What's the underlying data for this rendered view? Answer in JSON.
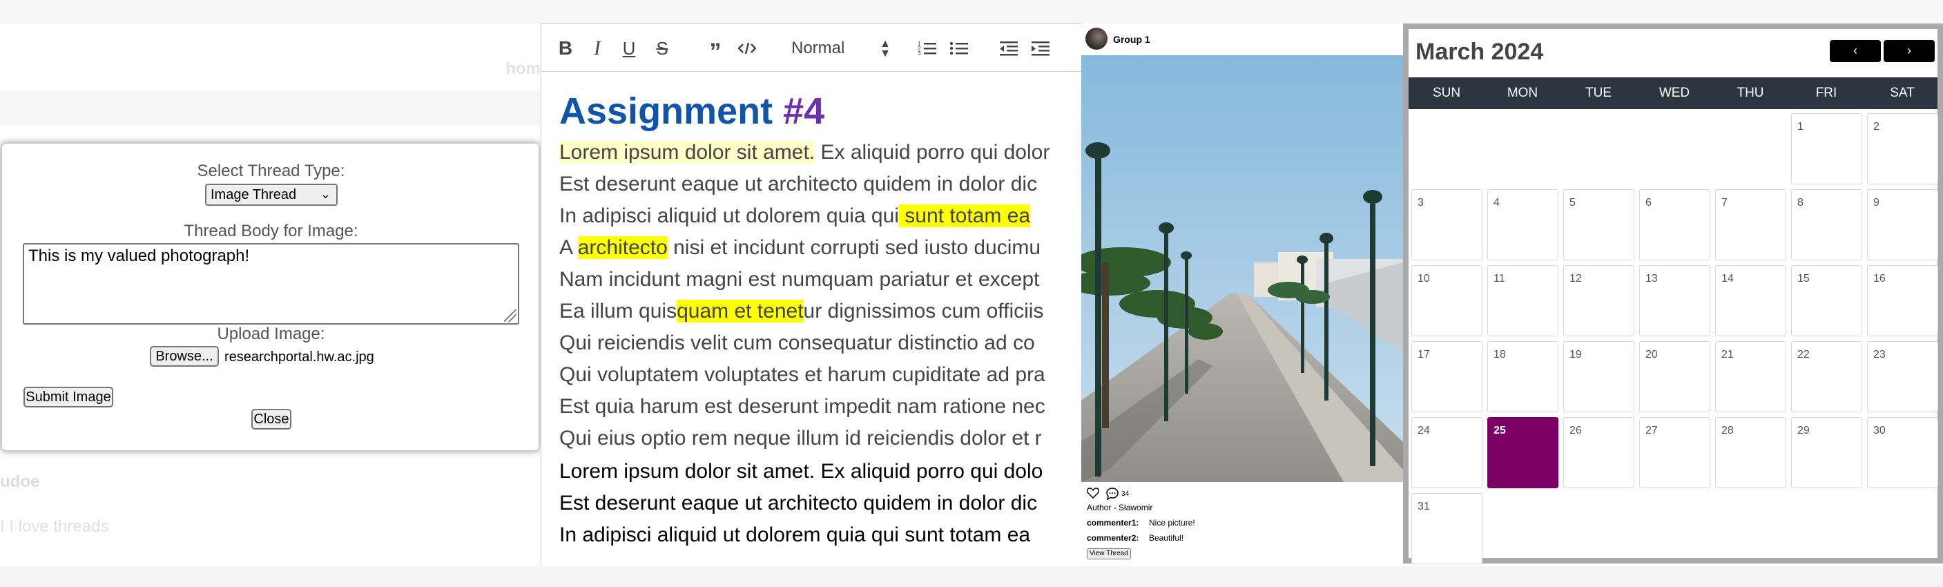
{
  "panel1": {
    "nav_home": "hom",
    "modal": {
      "select_label": "Select Thread Type:",
      "select_value": "Image Thread",
      "body_label": "Thread Body for Image:",
      "body_value": "This is my valued photograph!",
      "upload_label": "Upload Image:",
      "browse_label": "Browse...",
      "file_name": "researchportal.hw.ac.jpg",
      "submit_label": "Submit Image",
      "close_label": "Close"
    },
    "bg_author": "udoe",
    "bg_body": "I I love threads"
  },
  "panel2": {
    "toolbar": {
      "bold": "B",
      "italic": "I",
      "underline": "U",
      "strike": "S",
      "heading_select": "Normal"
    },
    "heading_main": "Assignment ",
    "heading_num": "#4",
    "lines": [
      [
        "",
        "Lorem ipsum dolor sit amet.",
        " Ex aliquid porro qui dolor"
      ],
      [
        "Est deserunt eaque ut architecto quidem in dolor dic",
        "",
        ""
      ],
      [
        "In adipisci aliquid ut dolorem quia qui",
        " sunt totam ea",
        ""
      ],
      [
        "A ",
        "architecto",
        " nisi et incidunt corrupti sed iusto ducimu"
      ],
      [
        "Nam incidunt magni est numquam pariatur et except",
        "",
        ""
      ],
      [
        "Ea illum quis",
        "quam et tenet",
        "ur dignissimos cum officiis"
      ],
      [
        "Qui reiciendis velit cum consequatur distinctio ad co",
        "",
        ""
      ],
      [
        "Qui voluptatem voluptates et harum cupiditate ad pra",
        "",
        ""
      ],
      [
        "Est quia harum est deserunt impedit nam ratione nec",
        "",
        ""
      ],
      [
        "Qui eius optio rem neque illum id reiciendis dolor et r",
        "",
        ""
      ],
      [
        "Lorem ipsum dolor sit amet. Ex aliquid porro qui dolo",
        "",
        ""
      ],
      [
        "Est deserunt eaque ut architecto quidem in dolor dic",
        "",
        ""
      ],
      [
        "In adipisci aliquid ut dolorem quia qui sunt totam ea",
        "",
        ""
      ]
    ]
  },
  "panel3": {
    "group_name": "Group 1",
    "comment_count": "34",
    "author": "Author - Sławomir",
    "comments": [
      {
        "user": "commenter1:",
        "text": "Nice picture!"
      },
      {
        "user": "commenter2:",
        "text": "Beautiful!"
      }
    ],
    "view_thread_label": "View Thread"
  },
  "panel4": {
    "month_title": "March 2024",
    "prev_label": "‹",
    "next_label": "›",
    "weekdays": [
      "SUN",
      "MON",
      "TUE",
      "WED",
      "THU",
      "FRI",
      "SAT"
    ],
    "days": [
      "1",
      "2",
      "3",
      "4",
      "5",
      "6",
      "7",
      "8",
      "9",
      "10",
      "11",
      "12",
      "13",
      "14",
      "15",
      "16",
      "17",
      "18",
      "19",
      "20",
      "21",
      "22",
      "23",
      "24",
      "25",
      "26",
      "27",
      "28",
      "29",
      "30",
      "31"
    ],
    "first_weekday_index": 5,
    "today": 25
  }
}
